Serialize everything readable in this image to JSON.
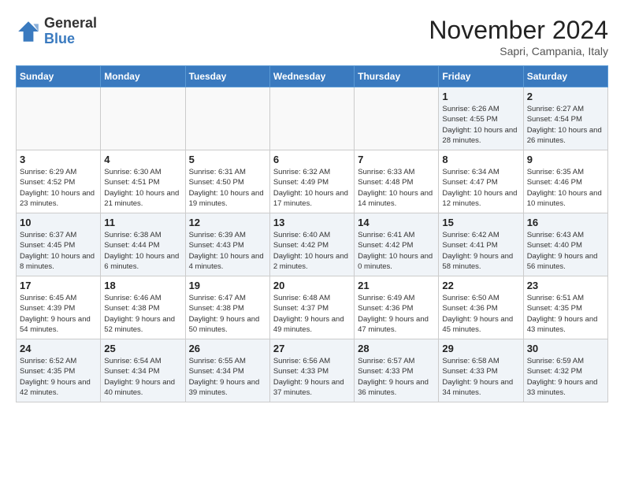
{
  "header": {
    "logo": {
      "general": "General",
      "blue": "Blue"
    },
    "title": "November 2024",
    "location": "Sapri, Campania, Italy"
  },
  "days_of_week": [
    "Sunday",
    "Monday",
    "Tuesday",
    "Wednesday",
    "Thursday",
    "Friday",
    "Saturday"
  ],
  "weeks": [
    [
      {
        "day": "",
        "info": ""
      },
      {
        "day": "",
        "info": ""
      },
      {
        "day": "",
        "info": ""
      },
      {
        "day": "",
        "info": ""
      },
      {
        "day": "",
        "info": ""
      },
      {
        "day": "1",
        "info": "Sunrise: 6:26 AM\nSunset: 4:55 PM\nDaylight: 10 hours and 28 minutes."
      },
      {
        "day": "2",
        "info": "Sunrise: 6:27 AM\nSunset: 4:54 PM\nDaylight: 10 hours and 26 minutes."
      }
    ],
    [
      {
        "day": "3",
        "info": "Sunrise: 6:29 AM\nSunset: 4:52 PM\nDaylight: 10 hours and 23 minutes."
      },
      {
        "day": "4",
        "info": "Sunrise: 6:30 AM\nSunset: 4:51 PM\nDaylight: 10 hours and 21 minutes."
      },
      {
        "day": "5",
        "info": "Sunrise: 6:31 AM\nSunset: 4:50 PM\nDaylight: 10 hours and 19 minutes."
      },
      {
        "day": "6",
        "info": "Sunrise: 6:32 AM\nSunset: 4:49 PM\nDaylight: 10 hours and 17 minutes."
      },
      {
        "day": "7",
        "info": "Sunrise: 6:33 AM\nSunset: 4:48 PM\nDaylight: 10 hours and 14 minutes."
      },
      {
        "day": "8",
        "info": "Sunrise: 6:34 AM\nSunset: 4:47 PM\nDaylight: 10 hours and 12 minutes."
      },
      {
        "day": "9",
        "info": "Sunrise: 6:35 AM\nSunset: 4:46 PM\nDaylight: 10 hours and 10 minutes."
      }
    ],
    [
      {
        "day": "10",
        "info": "Sunrise: 6:37 AM\nSunset: 4:45 PM\nDaylight: 10 hours and 8 minutes."
      },
      {
        "day": "11",
        "info": "Sunrise: 6:38 AM\nSunset: 4:44 PM\nDaylight: 10 hours and 6 minutes."
      },
      {
        "day": "12",
        "info": "Sunrise: 6:39 AM\nSunset: 4:43 PM\nDaylight: 10 hours and 4 minutes."
      },
      {
        "day": "13",
        "info": "Sunrise: 6:40 AM\nSunset: 4:42 PM\nDaylight: 10 hours and 2 minutes."
      },
      {
        "day": "14",
        "info": "Sunrise: 6:41 AM\nSunset: 4:42 PM\nDaylight: 10 hours and 0 minutes."
      },
      {
        "day": "15",
        "info": "Sunrise: 6:42 AM\nSunset: 4:41 PM\nDaylight: 9 hours and 58 minutes."
      },
      {
        "day": "16",
        "info": "Sunrise: 6:43 AM\nSunset: 4:40 PM\nDaylight: 9 hours and 56 minutes."
      }
    ],
    [
      {
        "day": "17",
        "info": "Sunrise: 6:45 AM\nSunset: 4:39 PM\nDaylight: 9 hours and 54 minutes."
      },
      {
        "day": "18",
        "info": "Sunrise: 6:46 AM\nSunset: 4:38 PM\nDaylight: 9 hours and 52 minutes."
      },
      {
        "day": "19",
        "info": "Sunrise: 6:47 AM\nSunset: 4:38 PM\nDaylight: 9 hours and 50 minutes."
      },
      {
        "day": "20",
        "info": "Sunrise: 6:48 AM\nSunset: 4:37 PM\nDaylight: 9 hours and 49 minutes."
      },
      {
        "day": "21",
        "info": "Sunrise: 6:49 AM\nSunset: 4:36 PM\nDaylight: 9 hours and 47 minutes."
      },
      {
        "day": "22",
        "info": "Sunrise: 6:50 AM\nSunset: 4:36 PM\nDaylight: 9 hours and 45 minutes."
      },
      {
        "day": "23",
        "info": "Sunrise: 6:51 AM\nSunset: 4:35 PM\nDaylight: 9 hours and 43 minutes."
      }
    ],
    [
      {
        "day": "24",
        "info": "Sunrise: 6:52 AM\nSunset: 4:35 PM\nDaylight: 9 hours and 42 minutes."
      },
      {
        "day": "25",
        "info": "Sunrise: 6:54 AM\nSunset: 4:34 PM\nDaylight: 9 hours and 40 minutes."
      },
      {
        "day": "26",
        "info": "Sunrise: 6:55 AM\nSunset: 4:34 PM\nDaylight: 9 hours and 39 minutes."
      },
      {
        "day": "27",
        "info": "Sunrise: 6:56 AM\nSunset: 4:33 PM\nDaylight: 9 hours and 37 minutes."
      },
      {
        "day": "28",
        "info": "Sunrise: 6:57 AM\nSunset: 4:33 PM\nDaylight: 9 hours and 36 minutes."
      },
      {
        "day": "29",
        "info": "Sunrise: 6:58 AM\nSunset: 4:33 PM\nDaylight: 9 hours and 34 minutes."
      },
      {
        "day": "30",
        "info": "Sunrise: 6:59 AM\nSunset: 4:32 PM\nDaylight: 9 hours and 33 minutes."
      }
    ]
  ]
}
